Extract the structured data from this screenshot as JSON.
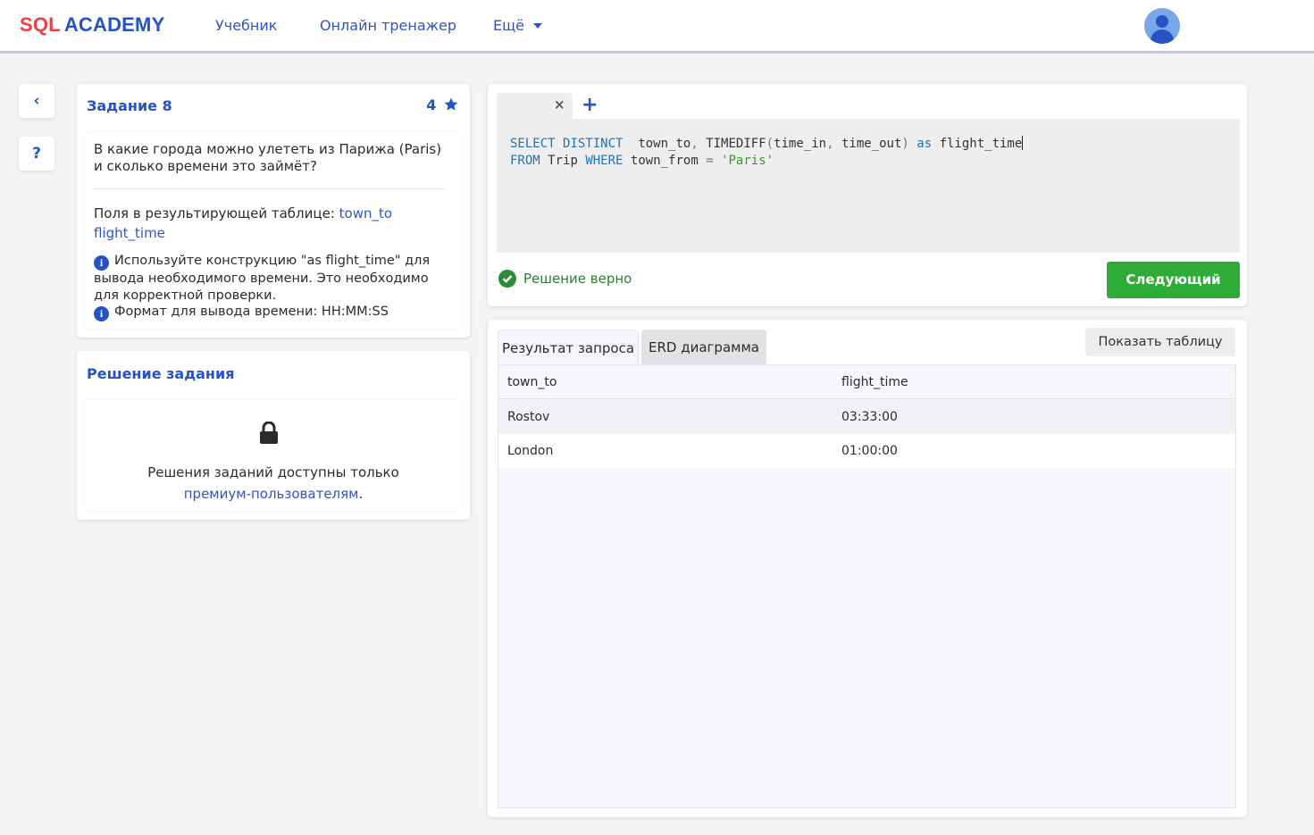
{
  "header": {
    "logo_sql": "SQL",
    "logo_academy": "ACADEMY",
    "nav": {
      "textbook": "Учебник",
      "trainer": "Онлайн тренажер",
      "more": "Ещё"
    },
    "colors": {
      "brand_red": "#e8414a",
      "brand_blue": "#2552c5"
    }
  },
  "sidebar": {
    "back_icon": "‹",
    "help_icon": "?"
  },
  "task": {
    "title": "Задание 8",
    "rating": "4",
    "question": "В какие города можно улететь из Парижа (Paris) и сколько времени это займёт?",
    "fields_label": "Поля в результирующей таблице:",
    "field_1": "town_to",
    "field_2": "flight_time",
    "note_1": "Используйте конструкцию \"as flight_time\" для вывода необходимого времени. Это необходимо для корректной проверки.",
    "note_2": "Формат для вывода времени: HH:MM:SS"
  },
  "solution": {
    "title": "Решение задания",
    "text": "Решения заданий доступны только",
    "link": "премиум-пользователям",
    "suffix": "."
  },
  "editor": {
    "close_icon": "×",
    "add_icon": "+",
    "code": {
      "select": "SELECT",
      "distinct": "DISTINCT",
      "town_to": "town_to",
      "comma": ",",
      "timediff": "TIMEDIFF",
      "lparen": "(",
      "time_in": "time_in",
      "time_out": "time_out",
      "rparen": ")",
      "as": "as",
      "alias": "flight_time",
      "from": "FROM",
      "table": "Trip",
      "where": "WHERE",
      "col": "town_from",
      "eq": "=",
      "value": "'Paris'"
    },
    "status": "Решение верно",
    "next_button": "Следующий"
  },
  "results": {
    "tabs": {
      "result": "Результат запроса",
      "erd": "ERD диаграмма"
    },
    "show_table_button": "Показать таблицу",
    "columns": [
      "town_to",
      "flight_time"
    ],
    "rows": [
      [
        "Rostov",
        "03:33:00"
      ],
      [
        "London",
        "01:00:00"
      ]
    ]
  }
}
